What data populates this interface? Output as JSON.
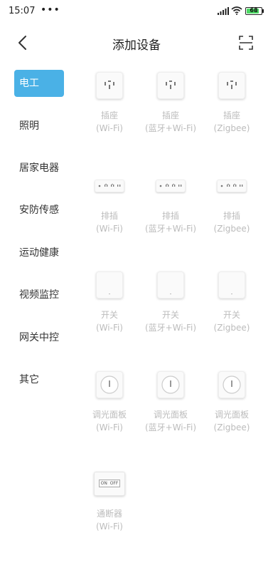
{
  "status_bar": {
    "time": "15:07",
    "dots": "•••",
    "battery": "68"
  },
  "header": {
    "title": "添加设备"
  },
  "sidebar": {
    "items": [
      {
        "label": "电工",
        "active": true
      },
      {
        "label": "照明"
      },
      {
        "label": "居家电器"
      },
      {
        "label": "安防传感"
      },
      {
        "label": "运动健康"
      },
      {
        "label": "视频监控"
      },
      {
        "label": "网关中控"
      },
      {
        "label": "其它"
      }
    ]
  },
  "devices": [
    {
      "name": "插座",
      "sub": "(Wi-Fi)",
      "icon": "socket-icon"
    },
    {
      "name": "插座",
      "sub": "(蓝牙+Wi-Fi)",
      "icon": "socket-icon"
    },
    {
      "name": "插座",
      "sub": "(Zigbee)",
      "icon": "socket-icon"
    },
    {
      "name": "排插",
      "sub": "(Wi-Fi)",
      "icon": "power-strip-icon"
    },
    {
      "name": "排插",
      "sub": "(蓝牙+Wi-Fi)",
      "icon": "power-strip-icon"
    },
    {
      "name": "排插",
      "sub": "(Zigbee)",
      "icon": "power-strip-icon"
    },
    {
      "name": "开关",
      "sub": "(Wi-Fi)",
      "icon": "switch-icon"
    },
    {
      "name": "开关",
      "sub": "(蓝牙+Wi-Fi)",
      "icon": "switch-icon"
    },
    {
      "name": "开关",
      "sub": "(Zigbee)",
      "icon": "switch-icon"
    },
    {
      "name": "调光面板",
      "sub": "(Wi-Fi)",
      "icon": "dimmer-icon"
    },
    {
      "name": "调光面板",
      "sub": "(蓝牙+Wi-Fi)",
      "icon": "dimmer-icon"
    },
    {
      "name": "调光面板",
      "sub": "(Zigbee)",
      "icon": "dimmer-icon"
    },
    {
      "name": "通断器",
      "sub": "(Wi-Fi)",
      "icon": "breaker-icon",
      "icon_text": "ON  OFF"
    }
  ]
}
